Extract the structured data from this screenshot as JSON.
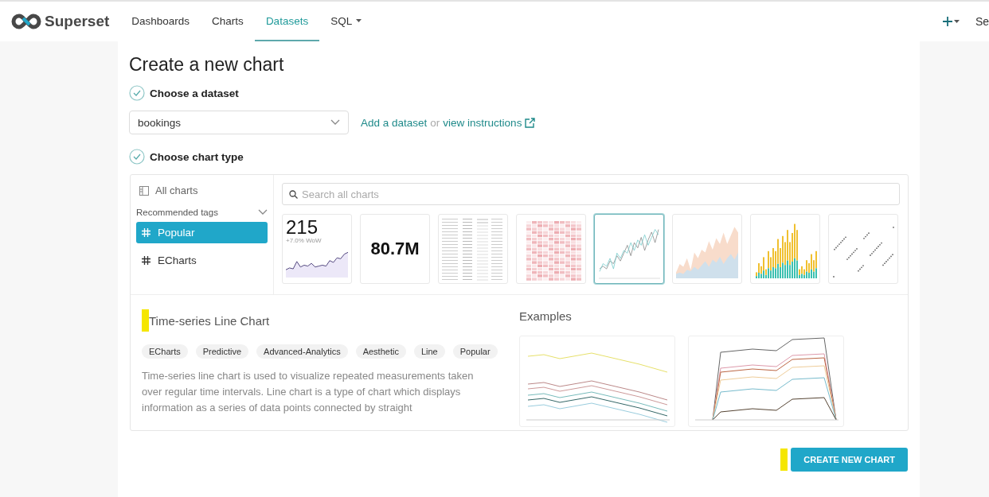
{
  "navbar": {
    "brand": "Superset",
    "items": [
      {
        "label": "Dashboards",
        "selected": false,
        "dropdown": false
      },
      {
        "label": "Charts",
        "selected": false,
        "dropdown": false
      },
      {
        "label": "Datasets",
        "selected": true,
        "dropdown": false
      },
      {
        "label": "SQL",
        "selected": false,
        "dropdown": true
      }
    ],
    "right_text": "Se"
  },
  "page": {
    "title": "Create a new chart",
    "step_1": {
      "label": "Choose a dataset",
      "done": true
    },
    "dataset_select": {
      "value": "bookings"
    },
    "dataset_links": {
      "add": "Add a dataset",
      "or": "or",
      "instructions": "view instructions"
    },
    "step_2": {
      "label": "Choose chart type",
      "done": true
    }
  },
  "chart_picker": {
    "sidebar": {
      "all_charts": "All charts",
      "section": "Recommended tags",
      "expanded": true,
      "tags": [
        {
          "label": "Popular",
          "selected": true
        },
        {
          "label": "ECharts",
          "selected": false
        }
      ]
    },
    "search": {
      "placeholder": "Search all charts"
    },
    "thumbnails": [
      {
        "kind": "big_number_trend",
        "value": "215",
        "subtitle": "+7.0% WoW",
        "selected": false
      },
      {
        "kind": "big_number",
        "value": "80.7M",
        "selected": false
      },
      {
        "kind": "table",
        "selected": false
      },
      {
        "kind": "pivot",
        "selected": false
      },
      {
        "kind": "line",
        "selected": true
      },
      {
        "kind": "area",
        "selected": false
      },
      {
        "kind": "bar",
        "selected": false
      },
      {
        "kind": "scatter",
        "selected": false
      }
    ],
    "details": {
      "title": "Time-series Line Chart",
      "highlighted": true,
      "tags": [
        "ECharts",
        "Predictive",
        "Advanced-Analytics",
        "Aesthetic",
        "Line",
        "Popular"
      ],
      "description": "Time-series line chart is used to visualize repeated measurements taken over regular time intervals. Line chart is a type of chart which displays information as a series of data points connected by straight",
      "examples_title": "Examples"
    }
  },
  "create_button": {
    "label": "CREATE NEW CHART",
    "highlighted": true
  }
}
